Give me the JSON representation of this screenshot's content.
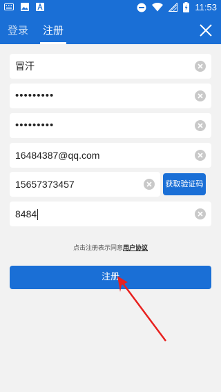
{
  "statusbar": {
    "time": "11:53"
  },
  "tabs": {
    "login": "登录",
    "register": "注册"
  },
  "form": {
    "username": "冒汗",
    "password": "•••••••••",
    "confirm_password": "•••••••••",
    "email": "16484387@qq.com",
    "phone": "15657373457",
    "code": "8484"
  },
  "buttons": {
    "get_code": "获取验证码",
    "register": "注册"
  },
  "agreement": {
    "prefix": "点击注册表示同意",
    "link": "用户协议"
  },
  "colors": {
    "primary": "#1a6fd6",
    "background": "#f2f2f2",
    "annotation_arrow": "#e8211f"
  }
}
